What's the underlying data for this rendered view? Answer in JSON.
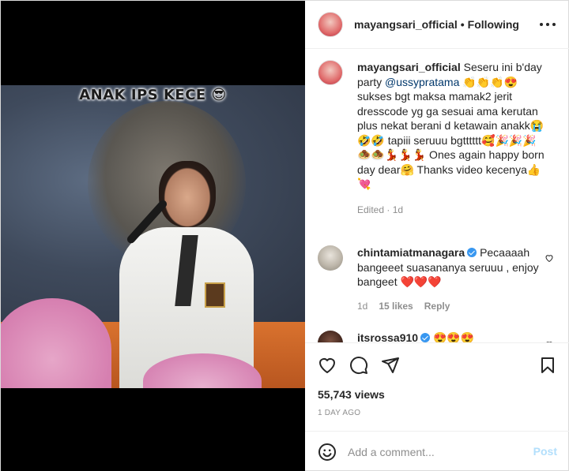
{
  "header": {
    "username": "mayangsari_official",
    "separator": "•",
    "follow_status": "Following"
  },
  "video": {
    "caption_text": "ANAK IPS KECE 😎"
  },
  "caption": {
    "username": "mayangsari_official",
    "text_before_mention": " Seseru ini b'day party ",
    "mention": "@ussypratama",
    "text_after_mention": " 👏👏👏😍 sukses bgt maksa mamak2 jerit dresscode yg ga sesuai ama kerutan plus nekat berani d ketawain anakk😭 🤣🤣 tapiii seruuu bgtttttt🥰🎉🎉🎉🧆🧆💃💃💃 Ones again happy born day dear🤗 Thanks video kecenya👍💘",
    "meta": "Edited · 1d"
  },
  "comments": [
    {
      "username": "chintamiatmanagara",
      "verified": true,
      "text": "Pecaaaah bangeeet suasananya seruuu , enjoy bangeet ❤️❤️❤️",
      "age": "1d",
      "likes": "15 likes",
      "reply": "Reply"
    },
    {
      "username": "itsrossa910",
      "verified": true,
      "text": "😍😍😍"
    }
  ],
  "stats": {
    "views": "55,743 views",
    "time_ago": "1 DAY AGO"
  },
  "add_comment": {
    "placeholder": "Add a comment...",
    "post_label": "Post"
  },
  "colors": {
    "primary_text": "#262626",
    "secondary_text": "#8e8e8e",
    "link": "#00376b",
    "post_disabled": "#b2dffc",
    "verified": "#3897f0"
  }
}
